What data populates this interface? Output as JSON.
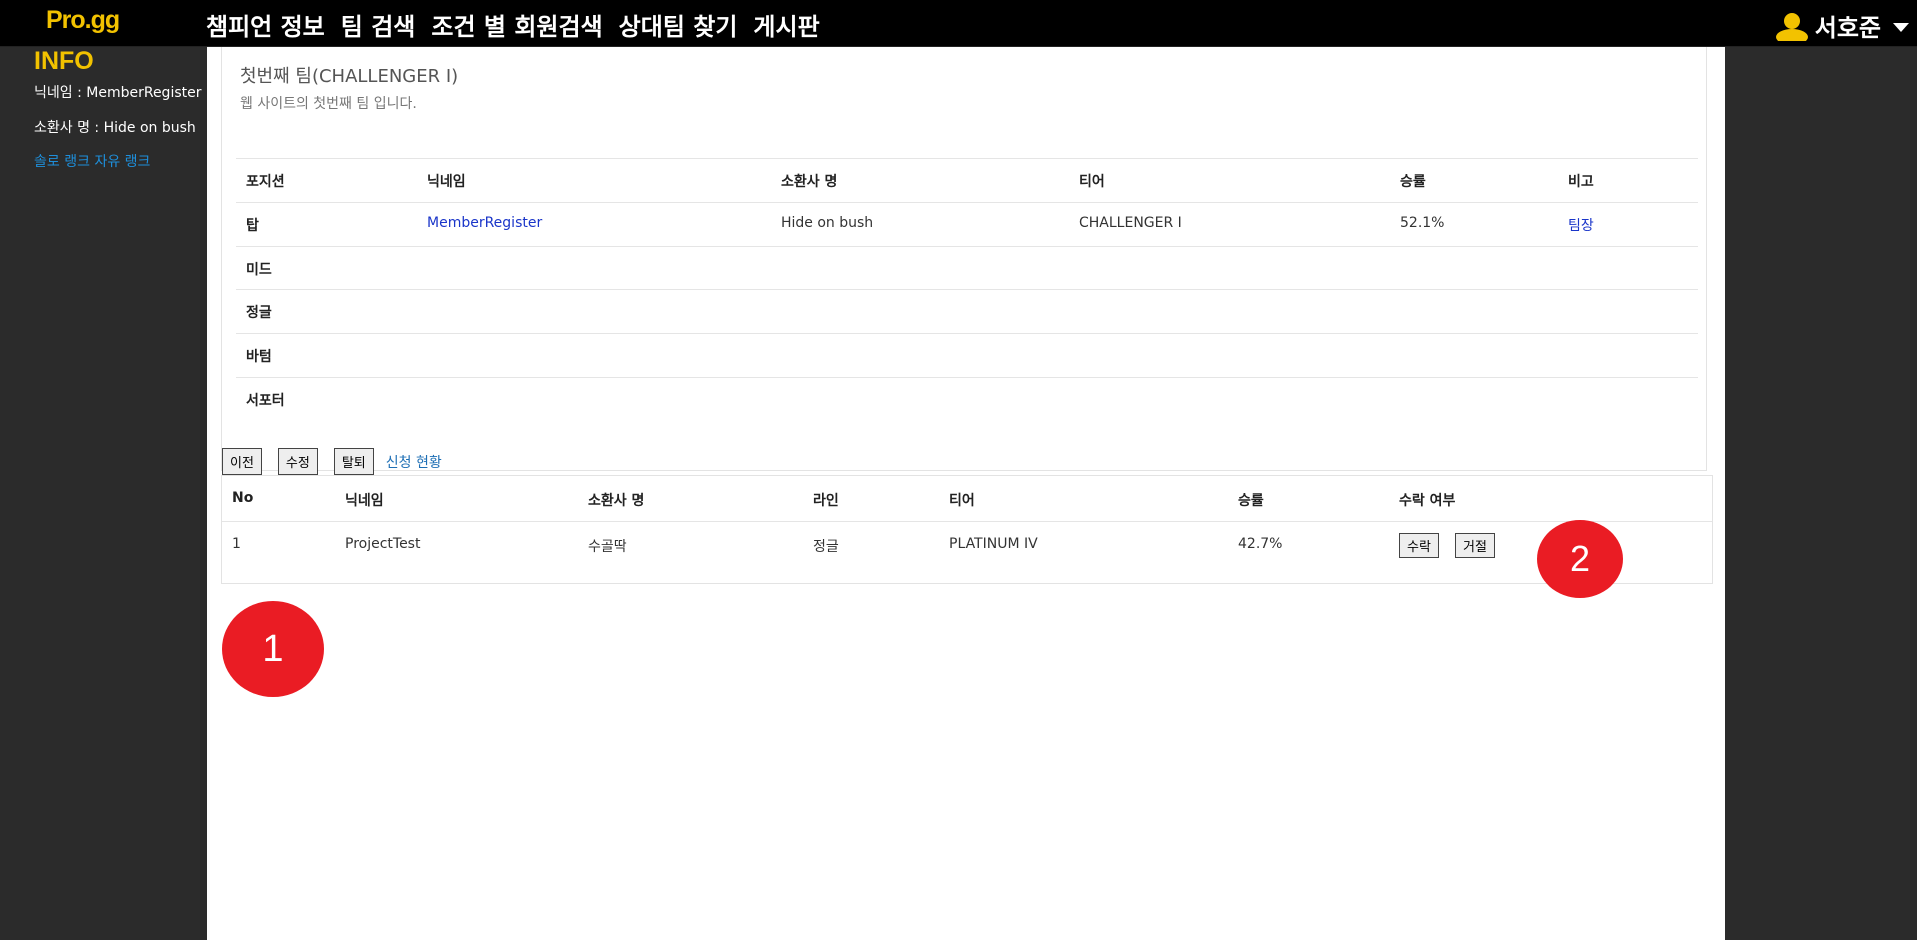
{
  "header": {
    "logo": "Pro.gg",
    "nav": [
      "챔피언 정보",
      "팀 검색",
      "조건 별 회원검색",
      "상대팀 찾기",
      "게시판"
    ],
    "user_name": "서호준"
  },
  "sidebar": {
    "title": "INFO",
    "nickname_line": "닉네임 : MemberRegister",
    "summoner_line": "소환사 명 : Hide on bush",
    "links": [
      "솔로 랭크",
      "자유 랭크"
    ]
  },
  "team": {
    "title": "첫번째 팀(CHALLENGER I)",
    "description": "웹 사이트의 첫번째 팀 입니다.",
    "columns": [
      "포지션",
      "닉네임",
      "소환사 명",
      "티어",
      "승률",
      "비고"
    ],
    "rows": [
      {
        "position": "탑",
        "nickname": "MemberRegister",
        "summoner": "Hide on bush",
        "tier": "CHALLENGER I",
        "winrate": "52.1%",
        "note": "팀장"
      },
      {
        "position": "미드",
        "nickname": "",
        "summoner": "",
        "tier": "",
        "winrate": "",
        "note": ""
      },
      {
        "position": "정글",
        "nickname": "",
        "summoner": "",
        "tier": "",
        "winrate": "",
        "note": ""
      },
      {
        "position": "바텀",
        "nickname": "",
        "summoner": "",
        "tier": "",
        "winrate": "",
        "note": ""
      },
      {
        "position": "서포터",
        "nickname": "",
        "summoner": "",
        "tier": "",
        "winrate": "",
        "note": ""
      }
    ]
  },
  "actions": {
    "prev": "이전",
    "edit": "수정",
    "leave": "탈퇴",
    "applications_link": "신청 현황"
  },
  "applications": {
    "columns": [
      "No",
      "닉네임",
      "소환사 명",
      "라인",
      "티어",
      "승률",
      "수락 여부"
    ],
    "rows": [
      {
        "no": "1",
        "nickname": "ProjectTest",
        "summoner": "수골딱",
        "line": "정글",
        "tier": "PLATINUM IV",
        "winrate": "42.7%",
        "accept": "수락",
        "reject": "거절"
      }
    ]
  },
  "markers": [
    "1",
    "2"
  ],
  "colors": {
    "accent": "#f2c200",
    "marker": "#ea1c24",
    "link": "#1a35c9"
  }
}
